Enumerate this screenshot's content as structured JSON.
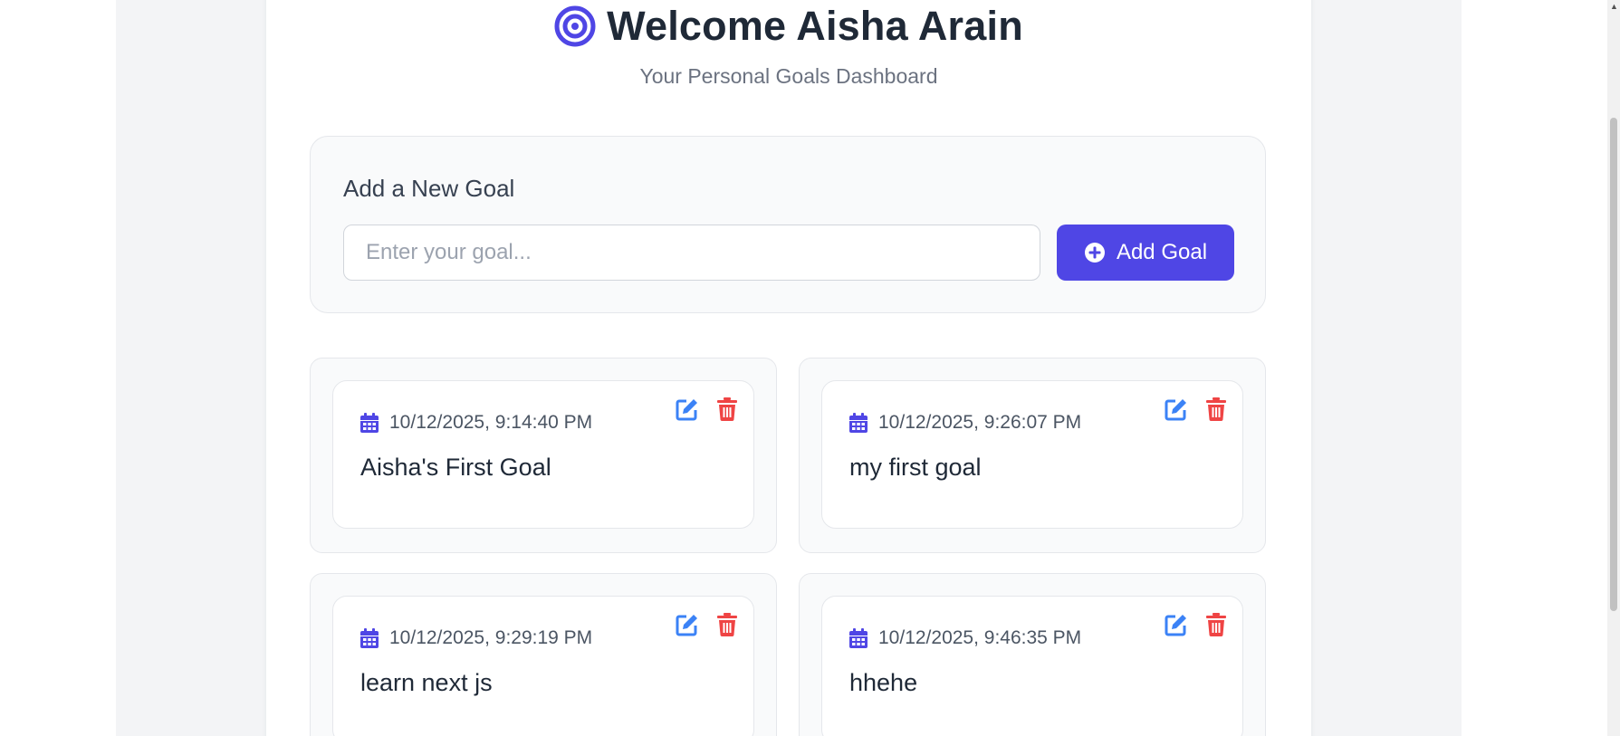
{
  "header": {
    "icon": "bullseye-icon",
    "title": "Welcome Aisha Arain",
    "subtitle": "Your Personal Goals Dashboard"
  },
  "add_goal": {
    "heading": "Add a New Goal",
    "input_placeholder": "Enter your goal...",
    "input_value": "",
    "button_label": "Add Goal",
    "button_icon": "plus-circle-icon"
  },
  "goals": [
    {
      "date": "10/12/2025, 9:14:40 PM",
      "text": "Aisha's First Goal"
    },
    {
      "date": "10/12/2025, 9:26:07 PM",
      "text": "my first goal"
    },
    {
      "date": "10/12/2025, 9:29:19 PM",
      "text": "learn next js"
    },
    {
      "date": "10/12/2025, 9:46:35 PM",
      "text": "hhehe"
    }
  ],
  "goal_icons": {
    "date": "calendar-icon",
    "edit": "edit-icon",
    "delete": "trash-icon"
  },
  "colors": {
    "accent": "#4f46e5",
    "edit": "#3b82f6",
    "delete": "#ef4444",
    "title": "#1f2937",
    "muted": "#6b7280"
  }
}
